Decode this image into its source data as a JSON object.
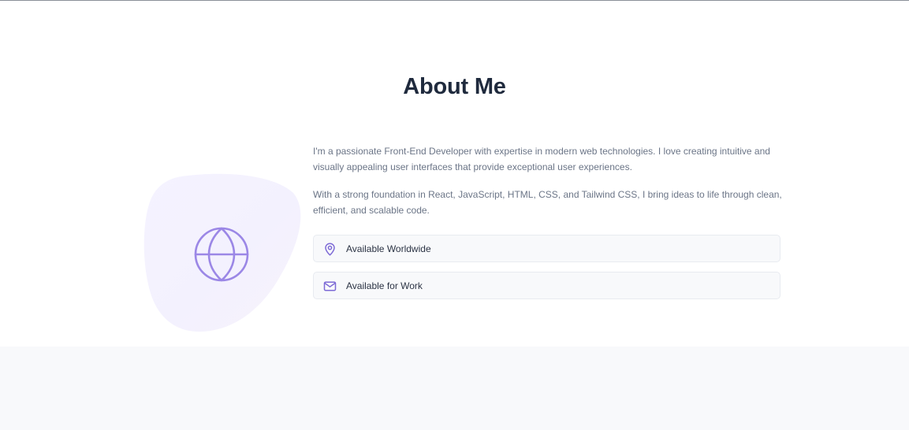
{
  "about": {
    "title": "About Me",
    "paragraphs": [
      "I'm a passionate Front-End Developer with expertise in modern web technologies. I love creating intuitive and visually appealing user interfaces that provide exceptional user experiences.",
      "With a strong foundation in React, JavaScript, HTML, CSS, and Tailwind CSS, I bring ideas to life through clean, efficient, and scalable code."
    ],
    "illustration_icon": "globe-icon",
    "info_cards": [
      {
        "icon": "map-pin-icon",
        "label": "Available Worldwide"
      },
      {
        "icon": "mail-icon",
        "label": "Available for Work"
      }
    ]
  },
  "colors": {
    "heading": "#1f2a3d",
    "body_text": "#6b7587",
    "accent": "#9b87e6",
    "card_background": "#f8f9fb",
    "section_background": "#f8f9fb"
  }
}
